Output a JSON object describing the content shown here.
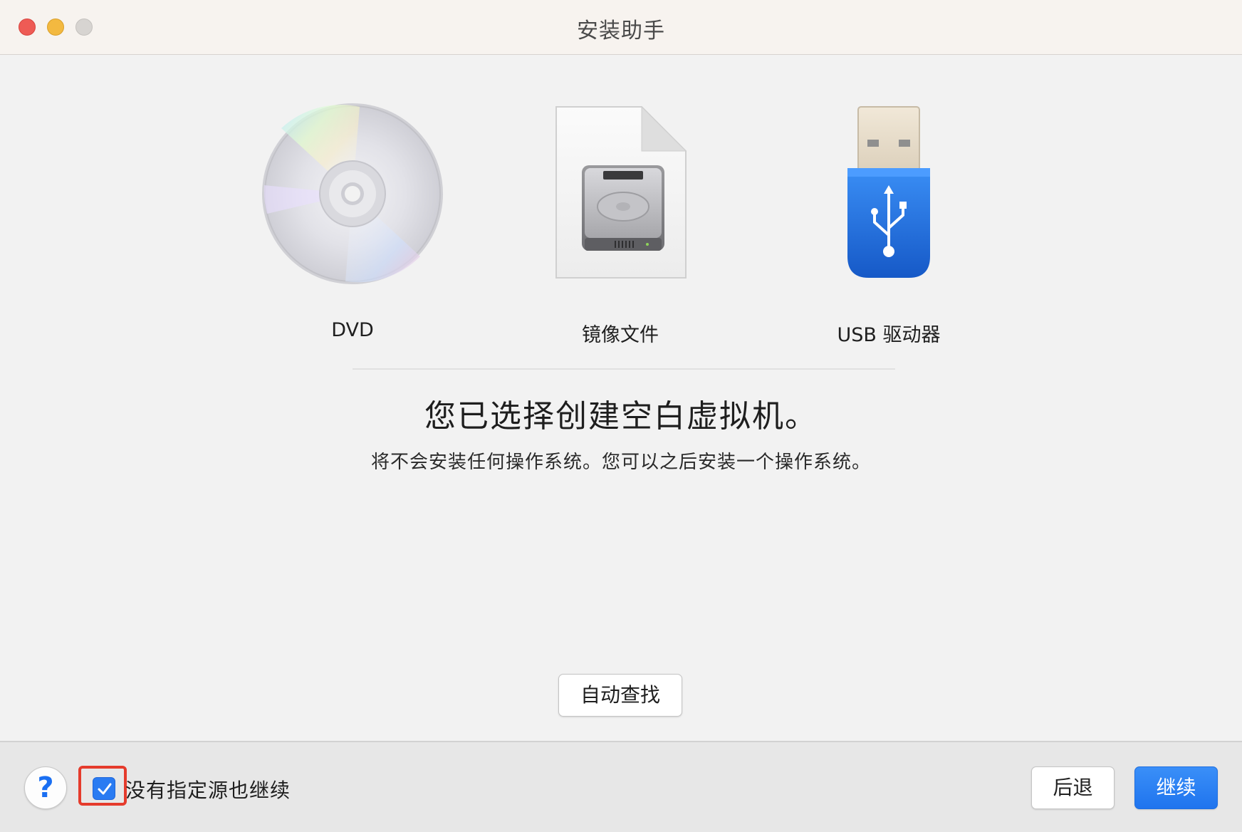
{
  "window": {
    "title": "安装助手"
  },
  "sources": [
    {
      "label": "DVD",
      "icon": "dvd-disc-icon"
    },
    {
      "label": "镜像文件",
      "icon": "disk-image-file-icon"
    },
    {
      "label": "USB 驱动器",
      "icon": "usb-drive-icon"
    }
  ],
  "main": {
    "headline": "您已选择创建空白虚拟机。",
    "subtext": "将不会安装任何操作系统。您可以之后安装一个操作系统。",
    "auto_find_label": "自动查找"
  },
  "footer": {
    "help_label": "?",
    "continue_without_source": {
      "label": "没有指定源也继续",
      "checked": true
    },
    "back_label": "后退",
    "continue_label": "继续"
  },
  "colors": {
    "accent": "#2b82f6",
    "highlight_border": "#e53b2c",
    "close": "#ee5b55",
    "minimize": "#f3b940",
    "zoom_inactive": "#d7d4d1"
  }
}
